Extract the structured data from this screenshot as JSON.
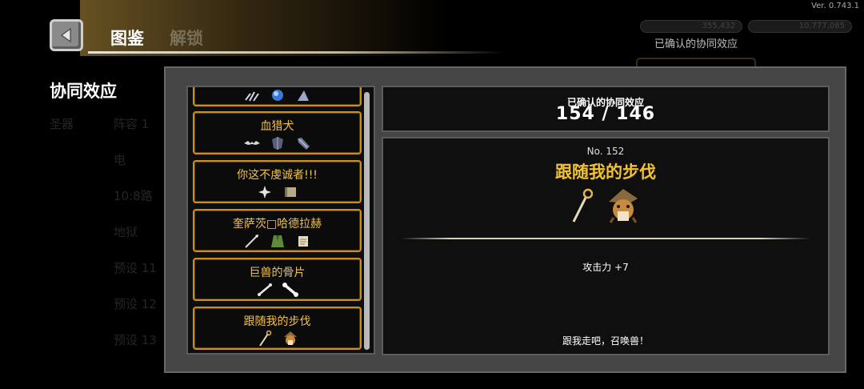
{
  "app": {
    "version": "Ver. 0.743.1",
    "title": "图鉴",
    "title_secondary": "解锁"
  },
  "top_right": {
    "confirmed_label": "已确认的协同效应",
    "currency_values": [
      "355,432",
      "10,777,085"
    ]
  },
  "sidebar": {
    "heading": "协同效应",
    "items": [
      {
        "label": "圣器"
      },
      {
        "label": "阵容 1"
      },
      {
        "label": "电"
      },
      {
        "label": "10:8路"
      },
      {
        "label": "地狱"
      },
      {
        "label": "预设 11"
      },
      {
        "label": "预设 12"
      },
      {
        "label": "预设 13"
      }
    ]
  },
  "synergy_list": [
    {
      "label": "",
      "icons": [
        "claw-icon",
        "blue-orb-icon",
        "spike-icon"
      ]
    },
    {
      "label": "血猎犬",
      "icons": [
        "bat-wing-icon",
        "dark-armor-icon",
        "gauntlet-icon"
      ]
    },
    {
      "label": "你这不虔诚者!!!",
      "icons": [
        "shuriken-icon",
        "tome-icon"
      ]
    },
    {
      "label": "奎萨茨□哈德拉赫",
      "icons": [
        "spear-icon",
        "green-cloak-icon",
        "scroll-icon"
      ]
    },
    {
      "label": "巨兽的骨片",
      "icons": [
        "small-bone-icon",
        "bone-icon"
      ]
    },
    {
      "label": "跟随我的步伐",
      "icons": [
        "staff-icon",
        "beast-icon"
      ]
    }
  ],
  "summary": {
    "label": "已确认的协同效应",
    "value": "154 / 146"
  },
  "detail": {
    "number": "No. 152",
    "title": "跟随我的步伐",
    "icons": [
      "staff-icon",
      "beast-icon"
    ],
    "stat": "攻击力 +7",
    "quote": "跟我走吧，召唤兽！"
  },
  "colors": {
    "gold": "#f2c230",
    "card_border": "#c9901e",
    "panel": "#454545"
  }
}
